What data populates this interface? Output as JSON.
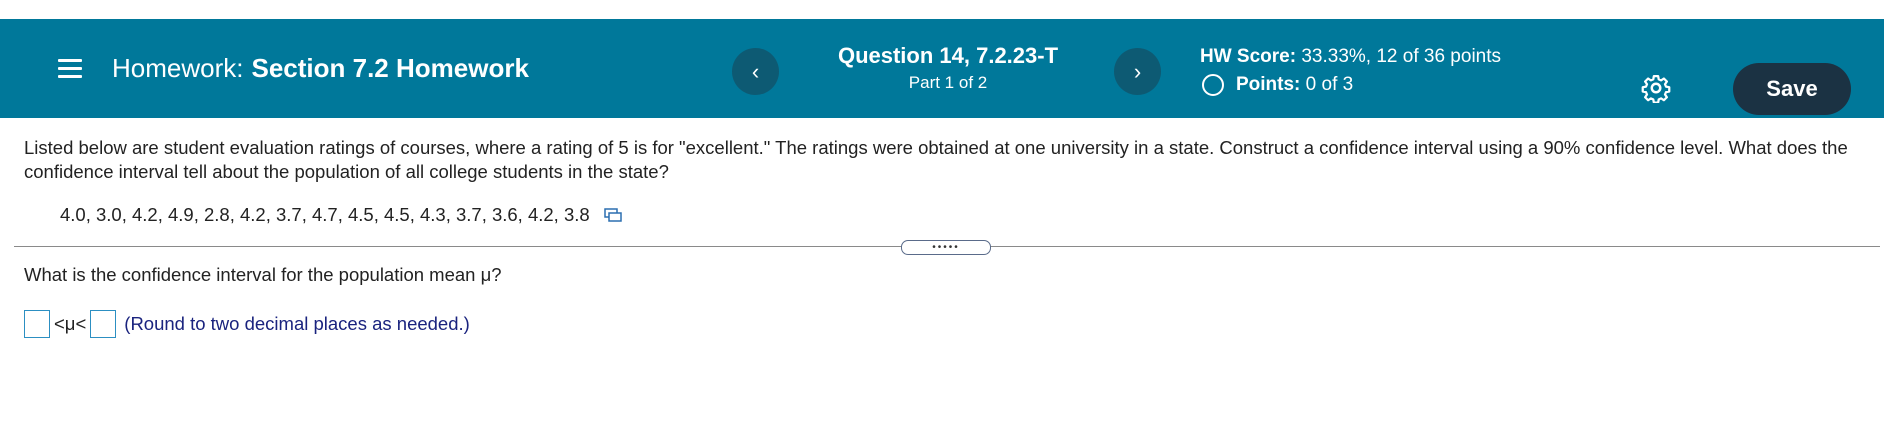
{
  "header": {
    "menu_icon": "hamburger-menu-icon",
    "homework_prefix": "Homework:",
    "homework_name": "Section 7.2 Homework",
    "prev_icon": "chevron-left-icon",
    "prev_glyph": "‹",
    "next_icon": "chevron-right-icon",
    "next_glyph": "›",
    "question_title": "Question 14, 7.2.23-T",
    "question_part": "Part 1 of 2",
    "score_label": "HW Score:",
    "score_value": "33.33%, 12 of 36 points",
    "points_label": "Points:",
    "points_value": "0 of 3",
    "settings_icon": "gear-icon",
    "save_label": "Save"
  },
  "problem": {
    "prompt": "Listed below are student evaluation ratings of courses, where a rating of 5 is for \"excellent.\" The ratings were obtained at one university in a state. Construct a confidence interval using a 90% confidence level. What does the confidence interval tell about the population of all college students in the state?",
    "data_values": "4.0, 3.0, 4.2, 4.9, 2.8, 4.2, 3.7, 4.7, 4.5, 4.5, 4.3, 3.7, 3.6, 4.2, 3.8",
    "copy_icon": "copy-data-icon",
    "expander_dots": "•••••",
    "question": "What is the confidence interval for the population mean μ?",
    "lower_bound_value": "",
    "upper_bound_value": "",
    "inequality": "<μ<",
    "hint": "(Round to two decimal places as needed.)"
  },
  "colors": {
    "header_bg": "#00789a",
    "nav_button_bg": "#0d5a73",
    "save_button_bg": "#1b3243",
    "input_border": "#2c8fc2",
    "hint_text": "#1a237e"
  }
}
